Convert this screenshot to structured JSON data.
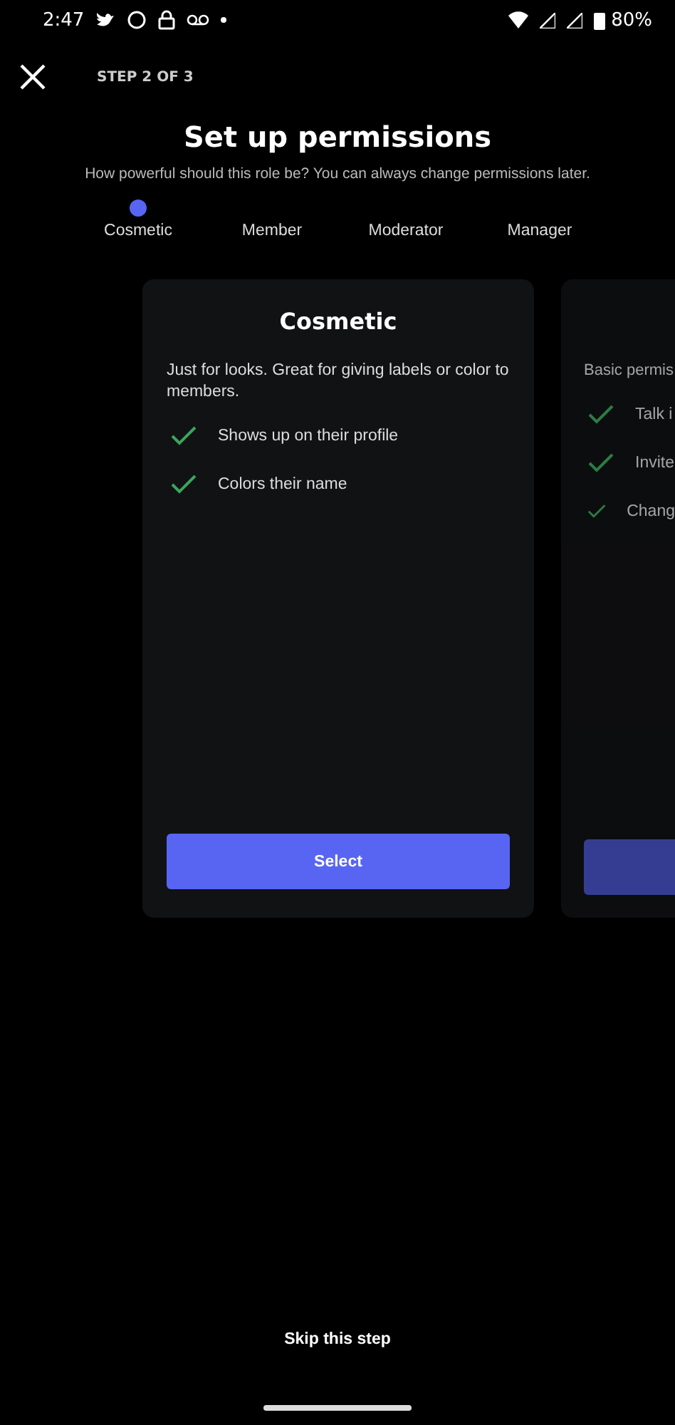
{
  "status_bar": {
    "time": "2:47",
    "battery": "80%"
  },
  "header": {
    "step": "STEP 2 OF 3"
  },
  "title": "Set up permissions",
  "subtitle": "How powerful should this role be? You can always change permissions later.",
  "steps": [
    {
      "label": "Cosmetic",
      "selected": true
    },
    {
      "label": "Member",
      "selected": false
    },
    {
      "label": "Moderator",
      "selected": false
    },
    {
      "label": "Manager",
      "selected": false
    }
  ],
  "cards": [
    {
      "title": "Cosmetic",
      "description": "Just for looks. Great for giving labels or color to members.",
      "features": [
        "Shows up on their profile",
        "Colors their name"
      ],
      "button": "Select",
      "selected": true
    },
    {
      "description": "Basic permis",
      "features": [
        "Talk i",
        "Invite",
        "Chang"
      ],
      "selected": false
    }
  ],
  "skip": "Skip this step"
}
